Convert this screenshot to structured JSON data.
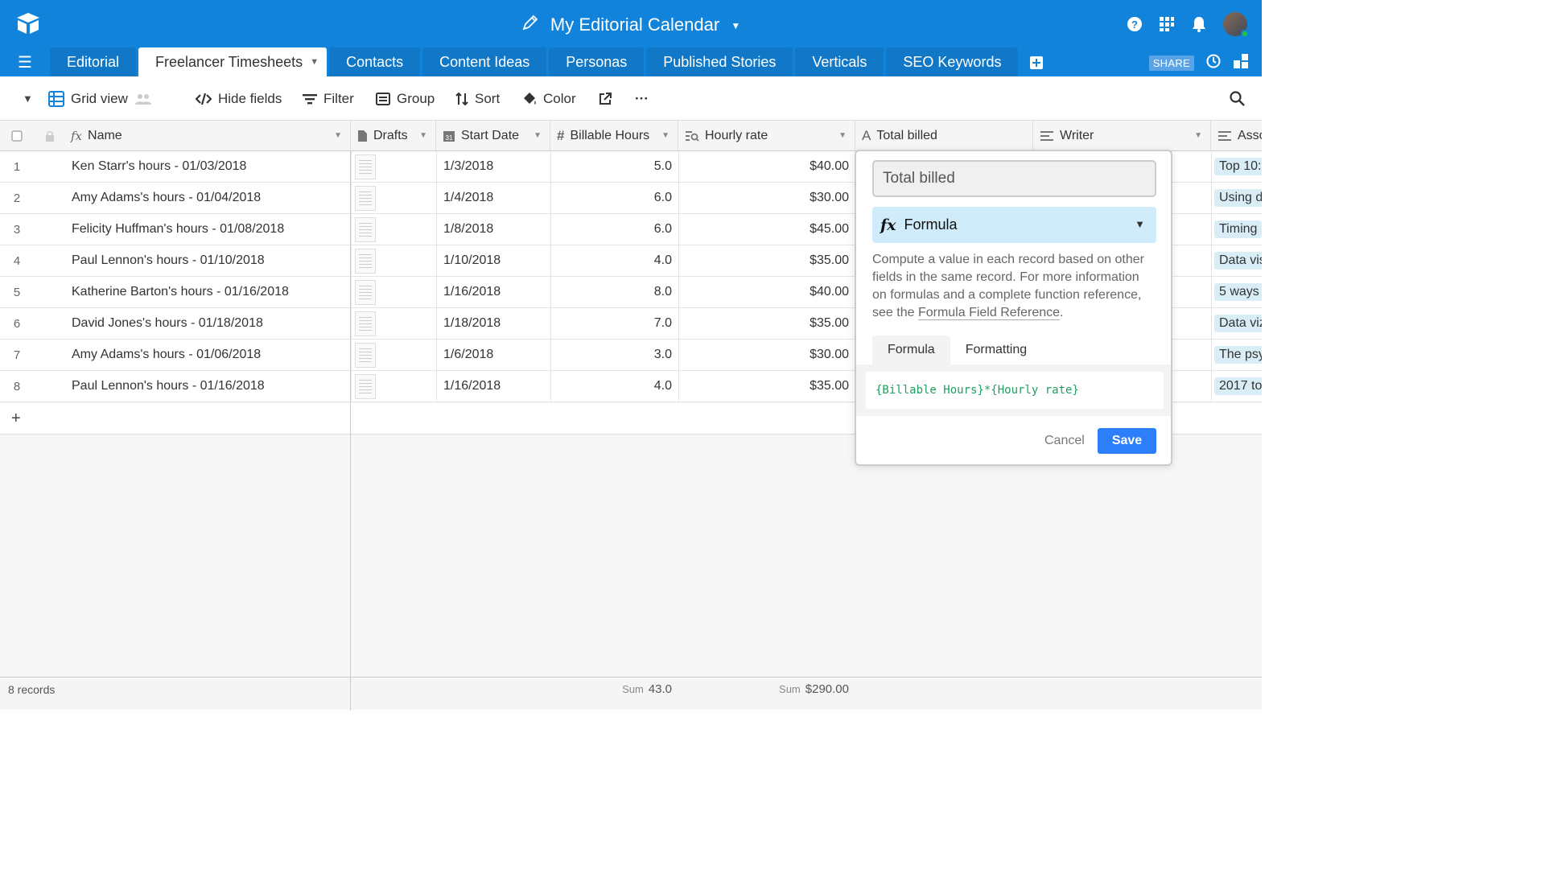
{
  "header": {
    "title": "My Editorial Calendar",
    "brand_color": "#1283da"
  },
  "tabs": [
    {
      "label": "Editorial"
    },
    {
      "label": "Freelancer Timesheets",
      "active": true
    },
    {
      "label": "Contacts"
    },
    {
      "label": "Content Ideas"
    },
    {
      "label": "Personas"
    },
    {
      "label": "Published Stories"
    },
    {
      "label": "Verticals"
    },
    {
      "label": "SEO Keywords"
    }
  ],
  "share_label": "SHARE",
  "toolbar": {
    "view_name": "Grid view",
    "hide_fields": "Hide fields",
    "filter": "Filter",
    "group": "Group",
    "sort": "Sort",
    "color": "Color",
    "more": "···"
  },
  "columns": {
    "name": "Name",
    "drafts": "Drafts",
    "start_date": "Start Date",
    "billable_hours": "Billable Hours",
    "hourly_rate": "Hourly rate",
    "total_billed": "Total billed",
    "writer": "Writer",
    "assoc": "Asso"
  },
  "rows": [
    {
      "n": "1",
      "name": "Ken Starr's hours - 01/03/2018",
      "date": "1/3/2018",
      "hours": "5.0",
      "rate": "$40.00",
      "assoc": "Top 10:"
    },
    {
      "n": "2",
      "name": "Amy Adams's hours - 01/04/2018",
      "date": "1/4/2018",
      "hours": "6.0",
      "rate": "$30.00",
      "assoc": "Using d"
    },
    {
      "n": "3",
      "name": "Felicity Huffman's hours - 01/08/2018",
      "date": "1/8/2018",
      "hours": "6.0",
      "rate": "$45.00",
      "assoc": "Timing"
    },
    {
      "n": "4",
      "name": "Paul Lennon's hours - 01/10/2018",
      "date": "1/10/2018",
      "hours": "4.0",
      "rate": "$35.00",
      "assoc": "Data vis"
    },
    {
      "n": "5",
      "name": "Katherine Barton's hours - 01/16/2018",
      "date": "1/16/2018",
      "hours": "8.0",
      "rate": "$40.00",
      "assoc": "5 ways t"
    },
    {
      "n": "6",
      "name": "David Jones's hours - 01/18/2018",
      "date": "1/18/2018",
      "hours": "7.0",
      "rate": "$35.00",
      "assoc": "Data viz"
    },
    {
      "n": "7",
      "name": "Amy Adams's hours - 01/06/2018",
      "date": "1/6/2018",
      "hours": "3.0",
      "rate": "$30.00",
      "assoc": "The psy"
    },
    {
      "n": "8",
      "name": "Paul Lennon's hours - 01/16/2018",
      "date": "1/16/2018",
      "hours": "4.0",
      "rate": "$35.00",
      "assoc": "2017 to"
    }
  ],
  "add_row": "+",
  "footer": {
    "records": "8 records",
    "sum_label": "Sum",
    "sum_hours": "43.0",
    "sum_rate": "$290.00"
  },
  "popover": {
    "field_name": "Total billed",
    "field_type": "Formula",
    "description": "Compute a value in each record based on other fields in the same record. For more information on formulas and a complete function reference, see the ",
    "link_text": "Formula Field Reference",
    "desc_end": ".",
    "tab_formula": "Formula",
    "tab_formatting": "Formatting",
    "formula": "{Billable Hours}*{Hourly rate}",
    "cancel": "Cancel",
    "save": "Save",
    "save_color": "#2d7ff9"
  }
}
